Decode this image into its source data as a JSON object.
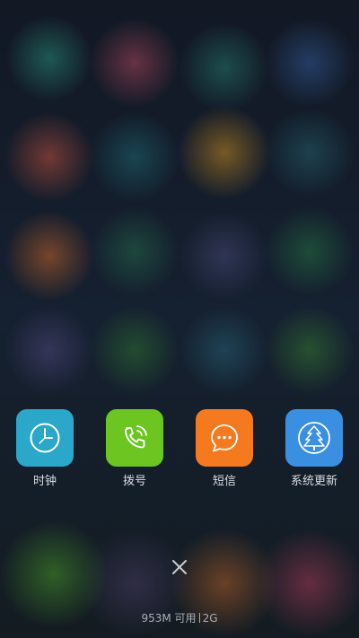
{
  "apps": [
    {
      "label": "时钟",
      "icon": "clock-icon",
      "color": "#2aa7c9"
    },
    {
      "label": "拨号",
      "icon": "phone-icon",
      "color": "#6cc520"
    },
    {
      "label": "短信",
      "icon": "message-icon",
      "color": "#f57a1f"
    },
    {
      "label": "系统更新",
      "icon": "update-tree-icon",
      "color": "#3b8fe0"
    }
  ],
  "close": {
    "icon": "close-icon"
  },
  "memory": {
    "available": "953M 可用",
    "total": "2G"
  }
}
